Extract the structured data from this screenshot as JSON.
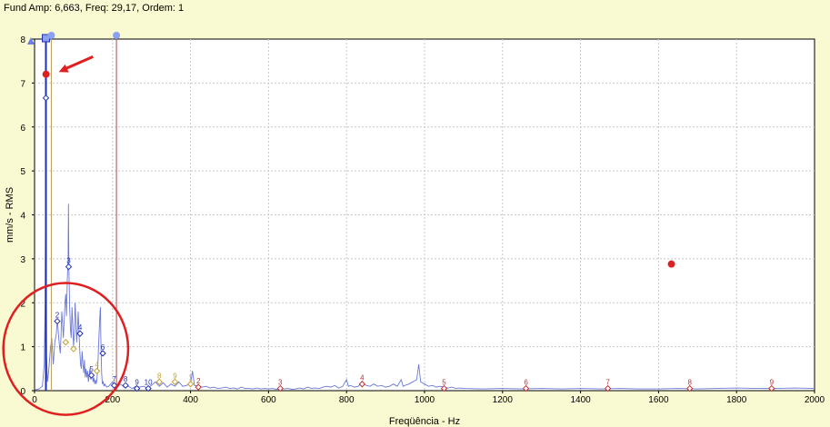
{
  "header": {
    "text": "Fund Amp: 6,663, Freq: 29,17, Ordem: 1"
  },
  "colors": {
    "background": "#fafad2",
    "plot": "#ffffff",
    "grid": "#c8c8c8",
    "spectrum": "#6a78d8",
    "cursor": "#2030b0",
    "harmonic_cursor": "#a05050",
    "fundamental_order": "#2030b0",
    "second_order": "#c8a030",
    "third_order": "#c03030",
    "annotation": "#e02020"
  },
  "chart_data": {
    "type": "line",
    "title": "",
    "xlabel": "Freqüência - Hz",
    "ylabel": "mm/s - RMS",
    "xlim": [
      0,
      2000
    ],
    "ylim": [
      0,
      8
    ],
    "xticks": [
      0,
      200,
      400,
      600,
      800,
      1000,
      1200,
      1400,
      1600,
      1800,
      2000
    ],
    "yticks": [
      0,
      1,
      2,
      3,
      4,
      5,
      6,
      7,
      8
    ],
    "grid": true,
    "series": [
      {
        "points": [
          [
            0,
            0.02
          ],
          [
            10,
            0.03
          ],
          [
            20,
            0.1
          ],
          [
            25,
            0.6
          ],
          [
            27,
            2.0
          ],
          [
            28,
            3.9
          ],
          [
            29,
            6.66
          ],
          [
            30,
            3.0
          ],
          [
            31,
            0.8
          ],
          [
            33,
            0.2
          ],
          [
            36,
            0.4
          ],
          [
            40,
            0.9
          ],
          [
            44,
            1.2
          ],
          [
            48,
            0.6
          ],
          [
            52,
            1.1
          ],
          [
            56,
            1.3
          ],
          [
            58,
            1.58
          ],
          [
            60,
            1.45
          ],
          [
            62,
            1.2
          ],
          [
            64,
            1.0
          ],
          [
            66,
            0.85
          ],
          [
            68,
            1.3
          ],
          [
            70,
            1.8
          ],
          [
            72,
            1.5
          ],
          [
            74,
            1.2
          ],
          [
            76,
            1.6
          ],
          [
            78,
            2.0
          ],
          [
            80,
            2.2
          ],
          [
            82,
            1.7
          ],
          [
            84,
            2.5
          ],
          [
            86,
            3.0
          ],
          [
            87,
            4.25
          ],
          [
            88,
            2.8
          ],
          [
            90,
            1.9
          ],
          [
            92,
            1.4
          ],
          [
            94,
            1.2
          ],
          [
            96,
            1.9
          ],
          [
            98,
            1.5
          ],
          [
            100,
            1.0
          ],
          [
            102,
            1.3
          ],
          [
            104,
            2.0
          ],
          [
            106,
            1.6
          ],
          [
            108,
            1.1
          ],
          [
            110,
            1.4
          ],
          [
            112,
            1.8
          ],
          [
            114,
            1.3
          ],
          [
            116,
            0.9
          ],
          [
            118,
            0.6
          ],
          [
            120,
            0.5
          ],
          [
            122,
            0.9
          ],
          [
            124,
            0.6
          ],
          [
            126,
            0.4
          ],
          [
            128,
            0.7
          ],
          [
            130,
            0.3
          ],
          [
            132,
            0.5
          ],
          [
            134,
            0.3
          ],
          [
            136,
            0.45
          ],
          [
            138,
            0.2
          ],
          [
            140,
            0.35
          ],
          [
            142,
            0.5
          ],
          [
            144,
            0.25
          ],
          [
            146,
            0.3
          ],
          [
            148,
            0.4
          ],
          [
            150,
            0.2
          ],
          [
            152,
            0.3
          ],
          [
            154,
            0.15
          ],
          [
            156,
            0.25
          ],
          [
            158,
            0.15
          ],
          [
            160,
            0.25
          ],
          [
            162,
            0.5
          ],
          [
            164,
            1.0
          ],
          [
            166,
            1.4
          ],
          [
            168,
            1.8
          ],
          [
            169,
            1.9
          ],
          [
            170,
            1.2
          ],
          [
            172,
            0.4
          ],
          [
            174,
            0.15
          ],
          [
            176,
            0.2
          ],
          [
            178,
            0.1
          ],
          [
            180,
            0.15
          ],
          [
            185,
            0.08
          ],
          [
            190,
            0.1
          ],
          [
            200,
            0.2
          ],
          [
            205,
            0.1
          ],
          [
            210,
            0.05
          ],
          [
            220,
            0.15
          ],
          [
            230,
            0.08
          ],
          [
            240,
            0.1
          ],
          [
            250,
            0.05
          ],
          [
            260,
            0.1
          ],
          [
            270,
            0.08
          ],
          [
            280,
            0.1
          ],
          [
            290,
            0.06
          ],
          [
            300,
            0.12
          ],
          [
            310,
            0.2
          ],
          [
            320,
            0.1
          ],
          [
            330,
            0.18
          ],
          [
            340,
            0.08
          ],
          [
            350,
            0.15
          ],
          [
            360,
            0.1
          ],
          [
            370,
            0.2
          ],
          [
            380,
            0.1
          ],
          [
            390,
            0.12
          ],
          [
            400,
            0.15
          ],
          [
            405,
            0.45
          ],
          [
            410,
            0.12
          ],
          [
            420,
            0.1
          ],
          [
            430,
            0.08
          ],
          [
            440,
            0.1
          ],
          [
            450,
            0.06
          ],
          [
            460,
            0.08
          ],
          [
            470,
            0.05
          ],
          [
            480,
            0.06
          ],
          [
            490,
            0.08
          ],
          [
            500,
            0.05
          ],
          [
            510,
            0.06
          ],
          [
            520,
            0.04
          ],
          [
            530,
            0.08
          ],
          [
            540,
            0.05
          ],
          [
            550,
            0.05
          ],
          [
            560,
            0.04
          ],
          [
            570,
            0.06
          ],
          [
            580,
            0.04
          ],
          [
            590,
            0.05
          ],
          [
            600,
            0.04
          ],
          [
            610,
            0.05
          ],
          [
            620,
            0.03
          ],
          [
            630,
            0.05
          ],
          [
            640,
            0.04
          ],
          [
            650,
            0.05
          ],
          [
            660,
            0.03
          ],
          [
            670,
            0.04
          ],
          [
            680,
            0.06
          ],
          [
            690,
            0.04
          ],
          [
            700,
            0.08
          ],
          [
            710,
            0.05
          ],
          [
            720,
            0.06
          ],
          [
            730,
            0.05
          ],
          [
            740,
            0.08
          ],
          [
            750,
            0.1
          ],
          [
            760,
            0.08
          ],
          [
            770,
            0.12
          ],
          [
            780,
            0.06
          ],
          [
            790,
            0.1
          ],
          [
            800,
            0.25
          ],
          [
            805,
            0.1
          ],
          [
            810,
            0.12
          ],
          [
            820,
            0.08
          ],
          [
            830,
            0.1
          ],
          [
            840,
            0.2
          ],
          [
            850,
            0.12
          ],
          [
            860,
            0.1
          ],
          [
            870,
            0.15
          ],
          [
            880,
            0.1
          ],
          [
            890,
            0.12
          ],
          [
            900,
            0.08
          ],
          [
            910,
            0.1
          ],
          [
            920,
            0.15
          ],
          [
            930,
            0.1
          ],
          [
            940,
            0.25
          ],
          [
            945,
            0.1
          ],
          [
            950,
            0.12
          ],
          [
            960,
            0.15
          ],
          [
            970,
            0.2
          ],
          [
            980,
            0.25
          ],
          [
            985,
            0.6
          ],
          [
            990,
            0.2
          ],
          [
            1000,
            0.15
          ],
          [
            1010,
            0.1
          ],
          [
            1020,
            0.12
          ],
          [
            1030,
            0.08
          ],
          [
            1040,
            0.1
          ],
          [
            1050,
            0.08
          ],
          [
            1060,
            0.06
          ],
          [
            1070,
            0.08
          ],
          [
            1080,
            0.05
          ],
          [
            1090,
            0.06
          ],
          [
            1100,
            0.05
          ],
          [
            1150,
            0.04
          ],
          [
            1200,
            0.05
          ],
          [
            1250,
            0.04
          ],
          [
            1300,
            0.05
          ],
          [
            1350,
            0.04
          ],
          [
            1400,
            0.05
          ],
          [
            1450,
            0.04
          ],
          [
            1500,
            0.05
          ],
          [
            1550,
            0.04
          ],
          [
            1600,
            0.04
          ],
          [
            1650,
            0.05
          ],
          [
            1700,
            0.04
          ],
          [
            1750,
            0.05
          ],
          [
            1800,
            0.06
          ],
          [
            1850,
            0.05
          ],
          [
            1900,
            0.05
          ],
          [
            1950,
            0.06
          ],
          [
            2000,
            0.05
          ]
        ]
      }
    ],
    "cursors": [
      {
        "x": 29.17,
        "style": "fundamental"
      },
      {
        "x": 43,
        "style": "secondary"
      },
      {
        "x": 210,
        "style": "harmonic"
      }
    ],
    "harmonic_markers": [
      {
        "x": 29.17,
        "y": 6.66,
        "label": "",
        "group": 1
      },
      {
        "x": 58.3,
        "y": 1.58,
        "label": "2",
        "group": 1
      },
      {
        "x": 87.5,
        "y": 2.82,
        "label": "3",
        "group": 1
      },
      {
        "x": 116.7,
        "y": 1.3,
        "label": "4",
        "group": 1
      },
      {
        "x": 145.8,
        "y": 0.35,
        "label": "5",
        "group": 1
      },
      {
        "x": 175,
        "y": 0.85,
        "label": "6",
        "group": 1
      },
      {
        "x": 204.2,
        "y": 0.12,
        "label": "7",
        "group": 1
      },
      {
        "x": 233.4,
        "y": 0.12,
        "label": "8",
        "group": 1
      },
      {
        "x": 262.5,
        "y": 0.05,
        "label": "9",
        "group": 1
      },
      {
        "x": 291.7,
        "y": 0.05,
        "label": "10",
        "group": 1
      },
      {
        "x": 80,
        "y": 1.1,
        "label": "",
        "group": 2
      },
      {
        "x": 100,
        "y": 0.95,
        "label": "",
        "group": 2
      },
      {
        "x": 160,
        "y": 0.45,
        "label": "4",
        "group": 2
      },
      {
        "x": 320,
        "y": 0.2,
        "label": "8",
        "group": 2
      },
      {
        "x": 360,
        "y": 0.2,
        "label": "9",
        "group": 2
      },
      {
        "x": 400,
        "y": 0.15,
        "label": "1",
        "group": 2
      },
      {
        "x": 420,
        "y": 0.08,
        "label": "2",
        "group": 3
      },
      {
        "x": 630,
        "y": 0.05,
        "label": "3",
        "group": 3
      },
      {
        "x": 840,
        "y": 0.15,
        "label": "4",
        "group": 3
      },
      {
        "x": 1050,
        "y": 0.05,
        "label": "5",
        "group": 3
      },
      {
        "x": 1260,
        "y": 0.05,
        "label": "6",
        "group": 3
      },
      {
        "x": 1470,
        "y": 0.05,
        "label": "7",
        "group": 3
      },
      {
        "x": 1680,
        "y": 0.05,
        "label": "8",
        "group": 3
      },
      {
        "x": 1890,
        "y": 0.05,
        "label": "9",
        "group": 3
      }
    ],
    "annotations": {
      "red_dots": [
        {
          "x": 29.5,
          "y": 7.2
        },
        {
          "x": 1633,
          "y": 2.88
        }
      ],
      "arrow": {
        "from": [
          150,
          7.6
        ],
        "to": [
          62,
          7.25
        ]
      },
      "circle": {
        "cx": 80,
        "cy": 0.95,
        "rx": 160,
        "ry": 1.5
      }
    }
  }
}
